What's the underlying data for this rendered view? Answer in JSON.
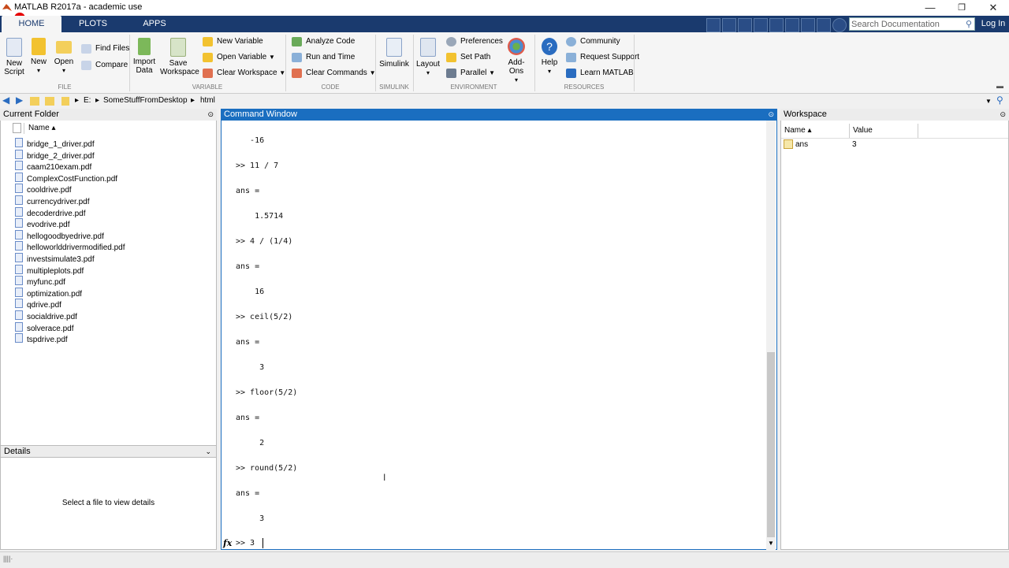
{
  "window": {
    "title": "MATLAB R2017a - academic use",
    "min": "—",
    "max": "❐",
    "close": "✕"
  },
  "tabs": [
    {
      "label": "HOME"
    },
    {
      "label": "PLOTS"
    },
    {
      "label": "APPS"
    }
  ],
  "search": {
    "placeholder": "Search Documentation"
  },
  "login_label": "Log In",
  "ribbon": {
    "file": {
      "new_script": [
        "New",
        "Script"
      ],
      "new": "New",
      "open": "Open",
      "find_files": "Find Files",
      "compare": "Compare",
      "group": "FILE"
    },
    "variable": {
      "import": [
        "Import",
        "Data"
      ],
      "save": [
        "Save",
        "Workspace"
      ],
      "new_variable": "New Variable",
      "open_variable": "Open Variable",
      "clear_workspace": "Clear Workspace",
      "group": "VARIABLE"
    },
    "code": {
      "analyze": "Analyze Code",
      "run_time": "Run and Time",
      "clear_commands": "Clear Commands",
      "group": "CODE"
    },
    "simulink": {
      "label": "Simulink",
      "group": "SIMULINK"
    },
    "environment": {
      "layout": "Layout",
      "preferences": "Preferences",
      "set_path": "Set Path",
      "parallel": "Parallel",
      "addons": "Add-Ons",
      "group": "ENVIRONMENT"
    },
    "resources": {
      "help": "Help",
      "community": "Community",
      "request_support": "Request Support",
      "learn": "Learn MATLAB",
      "group": "RESOURCES"
    }
  },
  "address": {
    "drive": "E:",
    "folder1": "SomeStuffFromDesktop",
    "folder2": "html"
  },
  "current_folder": {
    "title": "Current Folder",
    "col_name": "Name ▴",
    "files": [
      "bridge_1_driver.pdf",
      "bridge_2_driver.pdf",
      "caam210exam.pdf",
      "ComplexCostFunction.pdf",
      "cooldrive.pdf",
      "currencydriver.pdf",
      "decoderdrive.pdf",
      "evodrive.pdf",
      "hellogoodbyedrive.pdf",
      "helloworlddrivermodified.pdf",
      "investsimulate3.pdf",
      "multipleplots.pdf",
      "myfunc.pdf",
      "optimization.pdf",
      "qdrive.pdf",
      "socialdrive.pdf",
      "solverace.pdf",
      "tspdrive.pdf"
    ]
  },
  "details": {
    "title": "Details",
    "message": "Select a file to view details"
  },
  "command_window": {
    "title": "Command Window",
    "lines": [
      "   -16",
      "",
      ">> 11 / 7",
      "",
      "ans =",
      "",
      "    1.5714",
      "",
      ">> 4 / (1/4)",
      "",
      "ans =",
      "",
      "    16",
      "",
      ">> ceil(5/2)",
      "",
      "ans =",
      "",
      "     3",
      "",
      ">> floor(5/2)",
      "",
      "ans =",
      "",
      "     2",
      "",
      ">> round(5/2)",
      "",
      "ans =",
      "",
      "     3"
    ],
    "prompt": ">> 3",
    "fx": "fx"
  },
  "workspace": {
    "title": "Workspace",
    "col_name": "Name ▴",
    "col_value": "Value",
    "vars": [
      {
        "name": "ans",
        "value": "3"
      }
    ]
  },
  "colors": {
    "tabbar": "#1a3a6e",
    "cw_header": "#1a6ec0"
  }
}
